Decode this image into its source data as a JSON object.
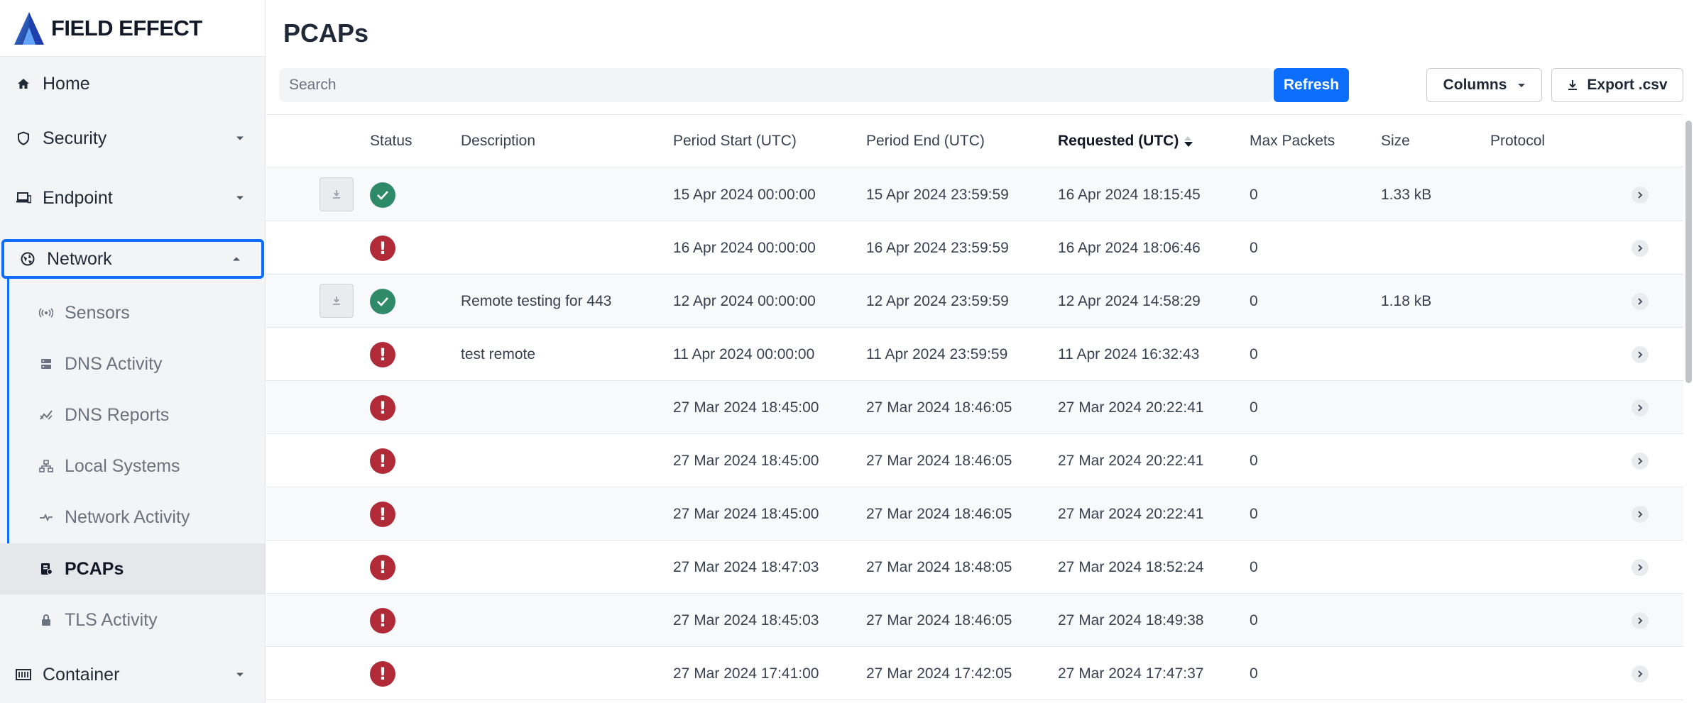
{
  "brand": {
    "name": "FIELD EFFECT",
    "logo_icon": "field-effect-logo"
  },
  "sidebar": {
    "top_items": [
      {
        "label": "Home",
        "icon": "home-icon"
      },
      {
        "label": "Security",
        "icon": "shield-icon"
      },
      {
        "label": "Endpoint",
        "icon": "laptop-icon"
      },
      {
        "label": "Network",
        "icon": "globe-icon"
      },
      {
        "label": "Container",
        "icon": "container-icon"
      }
    ],
    "network_sub_items": [
      {
        "label": "Sensors",
        "icon": "sensor-icon"
      },
      {
        "label": "DNS Activity",
        "icon": "server-icon"
      },
      {
        "label": "DNS Reports",
        "icon": "chart-icon"
      },
      {
        "label": "Local Systems",
        "icon": "sitemap-icon"
      },
      {
        "label": "Network Activity",
        "icon": "activity-icon"
      },
      {
        "label": "PCAPs",
        "icon": "pcap-icon",
        "active": true
      },
      {
        "label": "TLS Activity",
        "icon": "lock-icon"
      }
    ]
  },
  "page": {
    "title": "PCAPs"
  },
  "toolbar": {
    "search_placeholder": "Search",
    "refresh_label": "Refresh",
    "columns_label": "Columns",
    "export_label": "Export .csv"
  },
  "table": {
    "columns": [
      "Status",
      "Description",
      "Period Start (UTC)",
      "Period End (UTC)",
      "Requested (UTC)",
      "Max Packets",
      "Size",
      "Protocol"
    ],
    "sorted_column": "Requested (UTC)",
    "sort_direction": "descending",
    "rows": [
      {
        "downloadable": true,
        "status": "success",
        "description": "",
        "start": "15 Apr 2024 00:00:00",
        "end": "15 Apr 2024 23:59:59",
        "requested": "16 Apr 2024 18:15:45",
        "max_packets": "0",
        "size": "1.33 kB",
        "protocol": ""
      },
      {
        "downloadable": false,
        "status": "error",
        "description": "",
        "start": "16 Apr 2024 00:00:00",
        "end": "16 Apr 2024 23:59:59",
        "requested": "16 Apr 2024 18:06:46",
        "max_packets": "0",
        "size": "",
        "protocol": ""
      },
      {
        "downloadable": true,
        "status": "success",
        "description": "Remote testing for 443",
        "start": "12 Apr 2024 00:00:00",
        "end": "12 Apr 2024 23:59:59",
        "requested": "12 Apr 2024 14:58:29",
        "max_packets": "0",
        "size": "1.18 kB",
        "protocol": ""
      },
      {
        "downloadable": false,
        "status": "error",
        "description": "test remote",
        "start": "11 Apr 2024 00:00:00",
        "end": "11 Apr 2024 23:59:59",
        "requested": "11 Apr 2024 16:32:43",
        "max_packets": "0",
        "size": "",
        "protocol": ""
      },
      {
        "downloadable": false,
        "status": "error",
        "description": "",
        "start": "27 Mar 2024 18:45:00",
        "end": "27 Mar 2024 18:46:05",
        "requested": "27 Mar 2024 20:22:41",
        "max_packets": "0",
        "size": "",
        "protocol": ""
      },
      {
        "downloadable": false,
        "status": "error",
        "description": "",
        "start": "27 Mar 2024 18:45:00",
        "end": "27 Mar 2024 18:46:05",
        "requested": "27 Mar 2024 20:22:41",
        "max_packets": "0",
        "size": "",
        "protocol": ""
      },
      {
        "downloadable": false,
        "status": "error",
        "description": "",
        "start": "27 Mar 2024 18:45:00",
        "end": "27 Mar 2024 18:46:05",
        "requested": "27 Mar 2024 20:22:41",
        "max_packets": "0",
        "size": "",
        "protocol": ""
      },
      {
        "downloadable": false,
        "status": "error",
        "description": "",
        "start": "27 Mar 2024 18:47:03",
        "end": "27 Mar 2024 18:48:05",
        "requested": "27 Mar 2024 18:52:24",
        "max_packets": "0",
        "size": "",
        "protocol": ""
      },
      {
        "downloadable": false,
        "status": "error",
        "description": "",
        "start": "27 Mar 2024 18:45:03",
        "end": "27 Mar 2024 18:46:05",
        "requested": "27 Mar 2024 18:49:38",
        "max_packets": "0",
        "size": "",
        "protocol": ""
      },
      {
        "downloadable": false,
        "status": "error",
        "description": "",
        "start": "27 Mar 2024 17:41:00",
        "end": "27 Mar 2024 17:42:05",
        "requested": "27 Mar 2024 17:47:37",
        "max_packets": "0",
        "size": "",
        "protocol": ""
      }
    ]
  },
  "colors": {
    "accent": "#0d6efd",
    "success": "#2f8a6a",
    "error": "#b02a37"
  }
}
